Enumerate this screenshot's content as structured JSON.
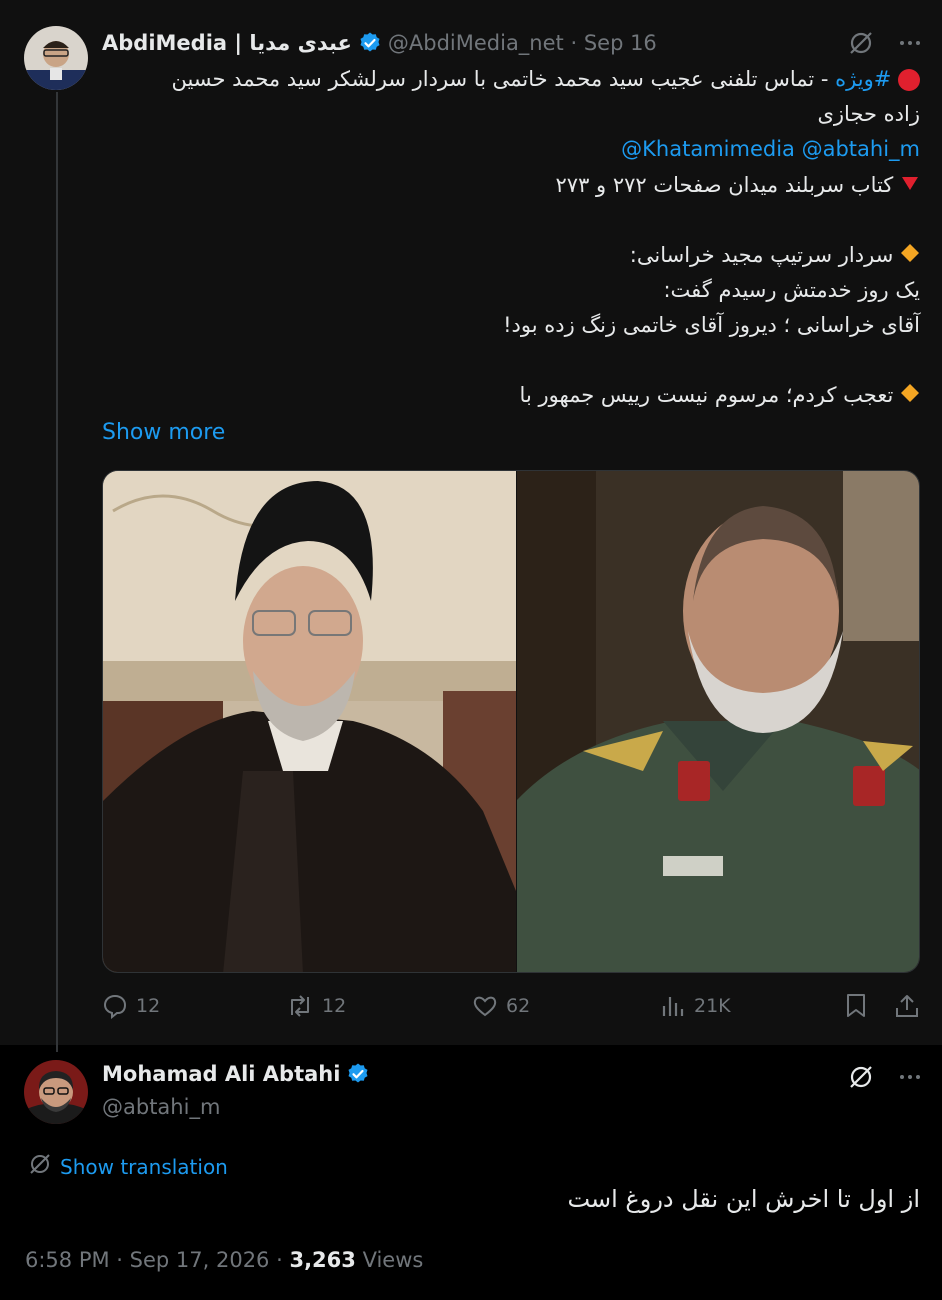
{
  "tweet": {
    "author_name": "AbdiMedia | عبدی مدیا",
    "handle": "@AbdiMedia_net",
    "date": "Sep 16",
    "line1_tag": "#ویژه",
    "line1_rest": " - تماس تلفنی عجیب سید محمد خاتمی با سردار سرلشکر سید محمد حسین",
    "line2": "زاده حجازی",
    "mention1": "@Khatamimedia",
    "mention2": "@abtahi_m",
    "line4": "کتاب سربلند میدان صفحات ۲۷۲ و ۲۷۳",
    "line5": "سردار سرتیپ مجید خراسانی:",
    "line6": "یک روز خدمتش رسیدم گفت:",
    "line7": "آقای خراسانی ؛ دیروز آقای خاتمی زنگ زده بود!",
    "line8": "تعجب کردم؛ مرسوم نیست رییس جمهور با",
    "show_more": "Show more",
    "replies": "12",
    "retweets": "12",
    "likes": "62",
    "views": "21K"
  },
  "reply": {
    "author_name": "Mohamad Ali Abtahi",
    "handle": "@abtahi_m",
    "show_translation": "Show translation",
    "text": "از اول تا اخرش این نقل دروغ است",
    "time": "6:58 PM · Sep 17, 2026 · ",
    "views_count": "3,263",
    "views_label": " Views"
  },
  "colors": {
    "accent": "#1d9bf0",
    "muted": "#71767b",
    "text": "#e7e9ea",
    "thread_bg": "#101010",
    "page_bg": "#000000"
  },
  "icons": [
    "grok-icon",
    "more-icon",
    "verified-badge-icon",
    "reply-icon",
    "retweet-icon",
    "like-icon",
    "views-icon",
    "bookmark-icon",
    "share-icon",
    "translate-icon",
    "red-circle-emoji",
    "red-triangle-emoji",
    "orange-diamond-emoji"
  ]
}
